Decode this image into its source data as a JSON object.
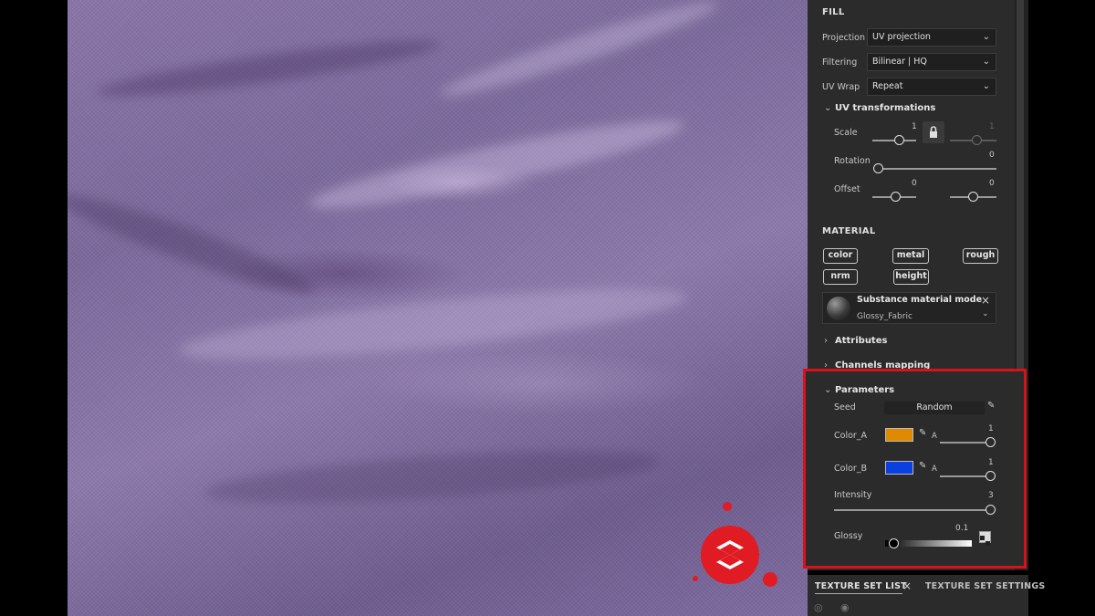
{
  "fill": {
    "title": "FILL",
    "projection": {
      "label": "Projection",
      "value": "UV projection"
    },
    "filtering": {
      "label": "Filtering",
      "value": "Bilinear | HQ"
    },
    "uv_wrap": {
      "label": "UV Wrap",
      "value": "Repeat"
    },
    "uv_transformations": {
      "title": "UV transformations",
      "scale": {
        "label": "Scale",
        "value_1": "1",
        "value_2": "1"
      },
      "rotation": {
        "label": "Rotation",
        "value": "0"
      },
      "offset": {
        "label": "Offset",
        "value_1": "0",
        "value_2": "0"
      }
    }
  },
  "material": {
    "title": "MATERIAL",
    "channels": [
      "color",
      "metal",
      "rough",
      "nrm",
      "height"
    ],
    "mode_title": "Substance material mode",
    "mode_value": "Glossy_Fabric",
    "sections": {
      "attributes": "Attributes",
      "channels_mapping": "Channels mapping"
    }
  },
  "parameters": {
    "title": "Parameters",
    "seed": {
      "label": "Seed",
      "value": "Random"
    },
    "color_a": {
      "label": "Color_A",
      "color": "#e08a00",
      "alpha_label": "A",
      "value": "1"
    },
    "color_b": {
      "label": "Color_B",
      "color": "#0a3fe0",
      "alpha_label": "A",
      "value": "1"
    },
    "intensity": {
      "label": "Intensity",
      "value": "3",
      "level": 1.0
    },
    "glossy": {
      "label": "Glossy",
      "value": "0.1",
      "level": 0.1
    }
  },
  "tabs": {
    "texture_set_list": "TEXTURE SET LIST",
    "texture_set_settings": "TEXTURE SET SETTINGS"
  },
  "colors": {
    "highlight": "#d8121b",
    "logo": "#e01b24",
    "fabric": "#8a76a8"
  }
}
